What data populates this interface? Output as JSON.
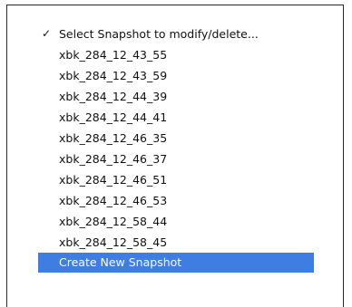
{
  "menu": {
    "current": {
      "check_glyph": "✓",
      "label": "Select Snapshot to modify/delete..."
    },
    "snapshots": [
      "xbk_284_12_43_55",
      "xbk_284_12_43_59",
      "xbk_284_12_44_39",
      "xbk_284_12_44_41",
      "xbk_284_12_46_35",
      "xbk_284_12_46_37",
      "xbk_284_12_46_51",
      "xbk_284_12_46_53",
      "xbk_284_12_58_44",
      "xbk_284_12_58_45"
    ],
    "create_label": "Create New Snapshot"
  },
  "colors": {
    "highlight": "#3e7ee2",
    "highlight_text": "#ffffff",
    "text": "#111111",
    "border": "#2a2a2a"
  }
}
